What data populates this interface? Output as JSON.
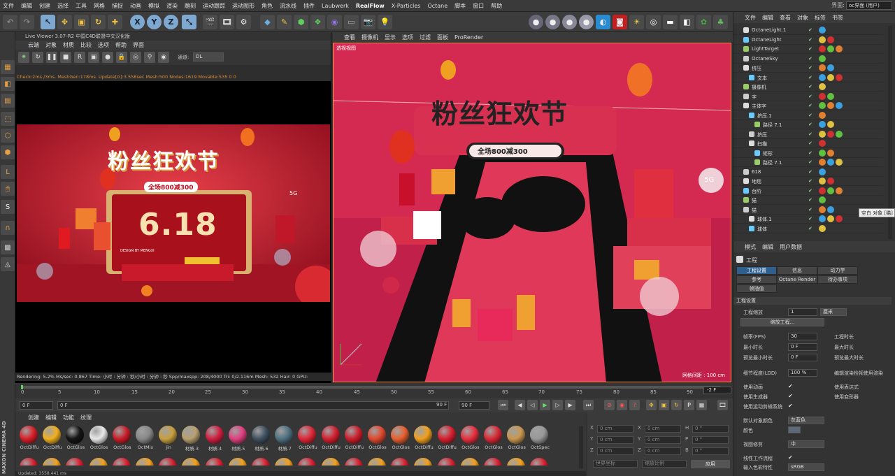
{
  "menubar": {
    "items": [
      "文件",
      "编辑",
      "创建",
      "选择",
      "工具",
      "网格",
      "捕捉",
      "动画",
      "模拟",
      "渲染",
      "雕刻",
      "运动跟踪",
      "运动图形",
      "角色",
      "流水线",
      "插件",
      "Laubwerk",
      "RealFlow",
      "X-Particles",
      "Octane",
      "脚本",
      "窗口",
      "帮助"
    ],
    "interface_label": "界面:",
    "interface_value": "oc界面 (用户)"
  },
  "toolbar": {
    "axis_x": "X",
    "axis_y": "Y",
    "axis_z": "Z"
  },
  "live_viewer": {
    "title": "Live Viewer 3.07-R2 中国C4D联盟中文汉化版",
    "menu": [
      "云端",
      "对象",
      "材质",
      "比较",
      "选项",
      "帮助",
      "界面"
    ],
    "channel_label": "通道:",
    "channel_value": "DL",
    "status": "Check:2ms./3ms. MeshGen:178ms. Update[G]:3.558sec Mesh:500 Nodes:1619 Movable:535  0 0",
    "bottom": "Rendering: 5.2%    Ms/sec: 0.867    Time: 小时 : 分钟 : 秒/小时 : 分钟 : 秒    Spp/maxspp: 208/4000    Tri: 0/2.116m  Mesh: 532  Hair: 0    GPU:",
    "render_title": "粉丝狂欢节",
    "render_sub": "全场800减300",
    "render_number": "6.18",
    "render_design": "DESIGN BY MENGXI",
    "render_5g": "5G"
  },
  "viewport": {
    "menu": [
      "查看",
      "摄像机",
      "显示",
      "选项",
      "过滤",
      "面板",
      "ProRender"
    ],
    "title": "透视视图",
    "grid": "网格间距 : 100 cm",
    "sign_title": "粉丝狂欢节",
    "sign_sub": "全场800减300",
    "badge": "5G"
  },
  "timeline": {
    "ticks": [
      "0",
      "5",
      "10",
      "15",
      "20",
      "25",
      "30",
      "35",
      "40",
      "45",
      "50",
      "55",
      "60",
      "65",
      "70",
      "75",
      "80",
      "85",
      "90"
    ],
    "frame": "-2 F"
  },
  "transport": {
    "start": "0 F",
    "current": "0 F",
    "end": "90 F",
    "end2": "90 F"
  },
  "materials": {
    "menu": [
      "创建",
      "编辑",
      "功能",
      "纹理"
    ],
    "items": [
      {
        "label": "OctDiffu",
        "color": "#d8202a"
      },
      {
        "label": "OctDiffu",
        "color": "#f0b020"
      },
      {
        "label": "OctGlos",
        "color": "#151515"
      },
      {
        "label": "OctGlos",
        "color": "#e8e8e8"
      },
      {
        "label": "OctGlos",
        "color": "#c81e2a"
      },
      {
        "label": "OctMix",
        "color": "#888888"
      },
      {
        "label": "jin",
        "color": "#c8a040"
      },
      {
        "label": "材质.3",
        "color": "#b8a070"
      },
      {
        "label": "材质.4",
        "color": "#d02040"
      },
      {
        "label": "材质.5",
        "color": "#e04080"
      },
      {
        "label": "材质.6",
        "color": "#405060"
      },
      {
        "label": "材质.7",
        "color": "#507080"
      },
      {
        "label": "OctDiffu",
        "color": "#e02838"
      },
      {
        "label": "OctDiffu",
        "color": "#d42030"
      },
      {
        "label": "OctDiffu",
        "color": "#cc1f2c"
      },
      {
        "label": "OctGlos",
        "color": "#e04a30"
      },
      {
        "label": "OctGlos",
        "color": "#e86030"
      },
      {
        "label": "OctDiffu",
        "color": "#f0a020"
      },
      {
        "label": "OctDiffu",
        "color": "#d82030"
      },
      {
        "label": "OctGlos",
        "color": "#e83040"
      },
      {
        "label": "OctGlos",
        "color": "#d82a36"
      },
      {
        "label": "OctGlos",
        "color": "#c89850"
      },
      {
        "label": "OctSpec",
        "color": "#999999"
      }
    ]
  },
  "coords": {
    "rows": [
      {
        "axis": "X",
        "val1": "0 cm",
        "axis2": "X",
        "val2": "0 cm",
        "axis3": "H",
        "val3": "0 °"
      },
      {
        "axis": "Y",
        "val1": "0 cm",
        "axis2": "Y",
        "val2": "0 cm",
        "axis3": "P",
        "val3": "0 °"
      },
      {
        "axis": "Z",
        "val1": "0 cm",
        "axis2": "Z",
        "val2": "0 cm",
        "axis3": "B",
        "val3": "0 °"
      }
    ],
    "world": "世界坐标",
    "scale": "缩放比例",
    "apply": "应用"
  },
  "objects": {
    "menu": [
      "文件",
      "编辑",
      "查看",
      "对象",
      "标签",
      "书签"
    ],
    "rows": [
      {
        "name": "OctaneLight.1",
        "indent": 1
      },
      {
        "name": "OctaneLight",
        "indent": 1
      },
      {
        "name": "LightTarget",
        "indent": 1
      },
      {
        "name": "OctaneSky",
        "indent": 1
      },
      {
        "name": "挤压",
        "indent": 1
      },
      {
        "name": "文本",
        "indent": 2
      },
      {
        "name": "摄像机",
        "indent": 1
      },
      {
        "name": "字",
        "indent": 1
      },
      {
        "name": "主体字",
        "indent": 1
      },
      {
        "name": "挤压.1",
        "indent": 2
      },
      {
        "name": "路径 7.1",
        "indent": 3
      },
      {
        "name": "挤压",
        "indent": 2
      },
      {
        "name": "扫描",
        "indent": 2
      },
      {
        "name": "矩形",
        "indent": 3
      },
      {
        "name": "路径 7.1",
        "indent": 3
      },
      {
        "name": "618",
        "indent": 1
      },
      {
        "name": "地毯",
        "indent": 1
      },
      {
        "name": "台阶",
        "indent": 1
      },
      {
        "name": "猫",
        "indent": 1
      },
      {
        "name": "猫",
        "indent": 1
      },
      {
        "name": "球体.1",
        "indent": 2
      },
      {
        "name": "球体",
        "indent": 2
      }
    ],
    "tooltip": "空白 对象 [猫]"
  },
  "attributes": {
    "menu": [
      "模式",
      "编辑",
      "用户数据"
    ],
    "section": "工程",
    "tabs_row1": [
      "工程设置",
      "信息",
      "动力学"
    ],
    "tabs_row2": [
      "参考",
      "Octane Render",
      "待办事项"
    ],
    "tabs_row3": [
      "帧插值"
    ],
    "group": "工程设置",
    "scale_label": "工程缩放",
    "scale_value": "1",
    "scale_unit": "厘米",
    "scale_btn": "缩放工程...",
    "fps_label": "帧率(FPS)",
    "fps_value": "30",
    "min_label": "最小时长",
    "min_value": "0 F",
    "preview_min_label": "预览最小时长",
    "preview_min_value": "0 F",
    "lod_label": "细节程度(LOD)",
    "lod_value": "100 %",
    "project_time": "工程时长",
    "max_time": "最大时长",
    "preview_max": "预览最大时长",
    "edit_lod": "编辑渲染检视使用渲染",
    "use_anim": "使用动画",
    "use_expr": "使用表达式",
    "use_gen": "使用生成器",
    "use_deform": "使用变形器",
    "use_motion": "使用运动剪辑系统",
    "default_color_label": "默认对象颜色",
    "default_color_value": "灰蓝色",
    "color_label": "颜色",
    "view_label": "视图修剪",
    "view_value": "中",
    "linear_label": "线性工作流程",
    "input_label": "输入色彩特性",
    "input_value": "sRGB"
  },
  "status": {
    "text": "Updated: 3558.441 ms"
  },
  "brand": "MAXON CINEMA 4D"
}
